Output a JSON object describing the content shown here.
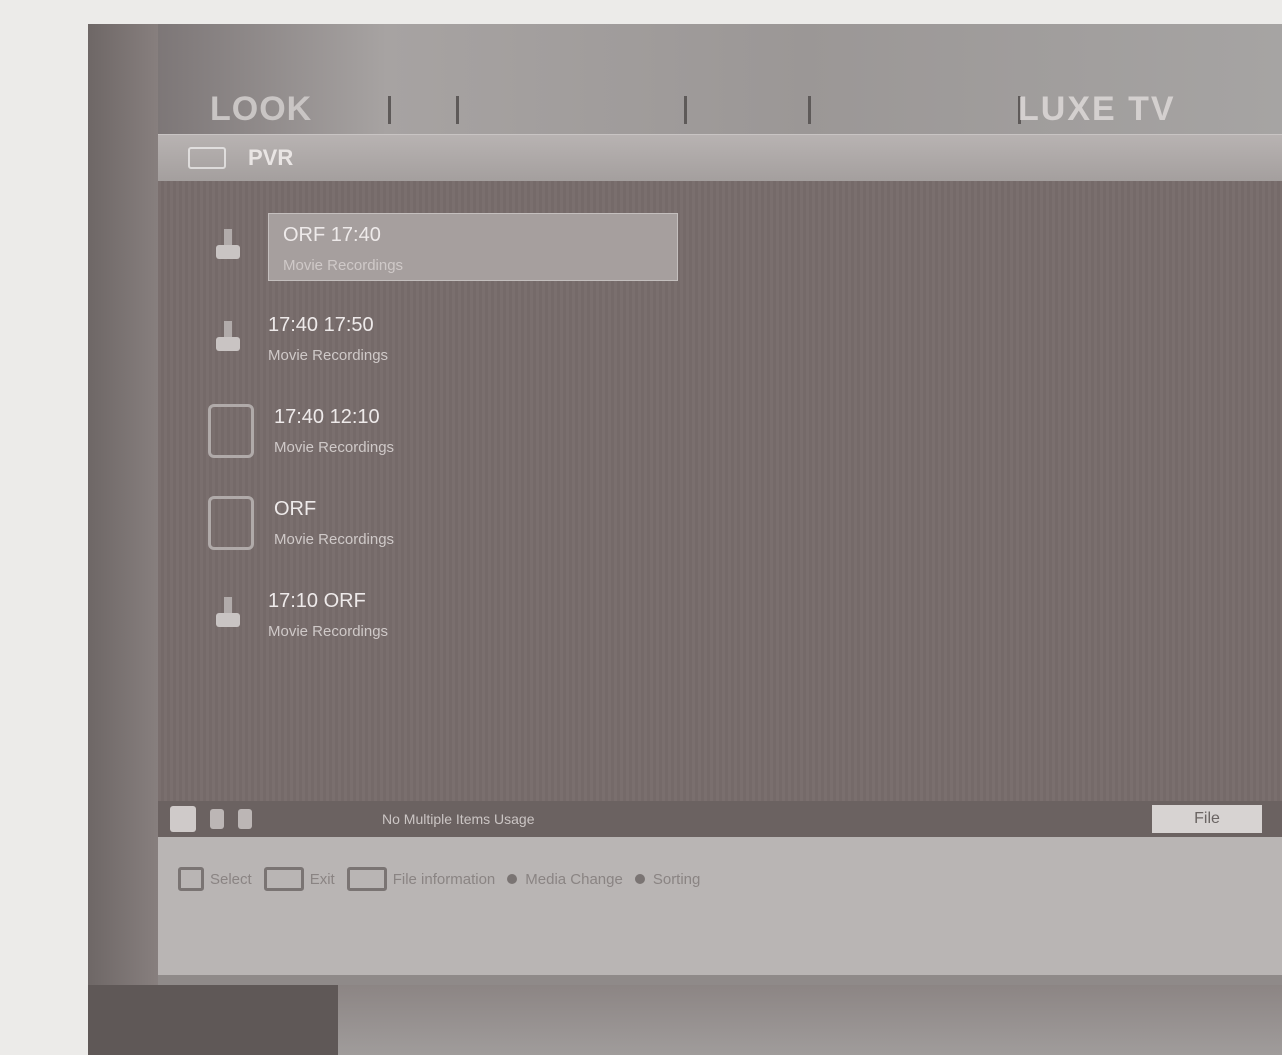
{
  "tv": {
    "brand_left": "LOOK",
    "brand_right": "LUXE TV"
  },
  "panel": {
    "title": "PVR",
    "items": [
      {
        "name": "ORF 17:40",
        "sub": "Movie Recordings",
        "icon": "usb-icon",
        "selected": true
      },
      {
        "name": "17:40 17:50",
        "sub": "Movie Recordings",
        "icon": "usb-icon",
        "selected": false
      },
      {
        "name": "17:40 12:10",
        "sub": "Movie Recordings",
        "icon": "folder-icon",
        "selected": false
      },
      {
        "name": "ORF",
        "sub": "Movie Recordings",
        "icon": "folder-icon",
        "selected": false
      },
      {
        "name": "17:10 ORF",
        "sub": "Movie Recordings",
        "icon": "usb-icon",
        "selected": false
      }
    ],
    "footer_status": "No Multiple Items Usage",
    "footer_button": "File"
  },
  "nav": {
    "hints": [
      {
        "key": "OK",
        "label": "Select"
      },
      {
        "key": "EXIT",
        "label": "Exit"
      },
      {
        "key": "INFO",
        "label": "File information"
      },
      {
        "key": "dot",
        "label": "Media Change"
      },
      {
        "key": "dot2",
        "label": "Sorting"
      }
    ]
  }
}
